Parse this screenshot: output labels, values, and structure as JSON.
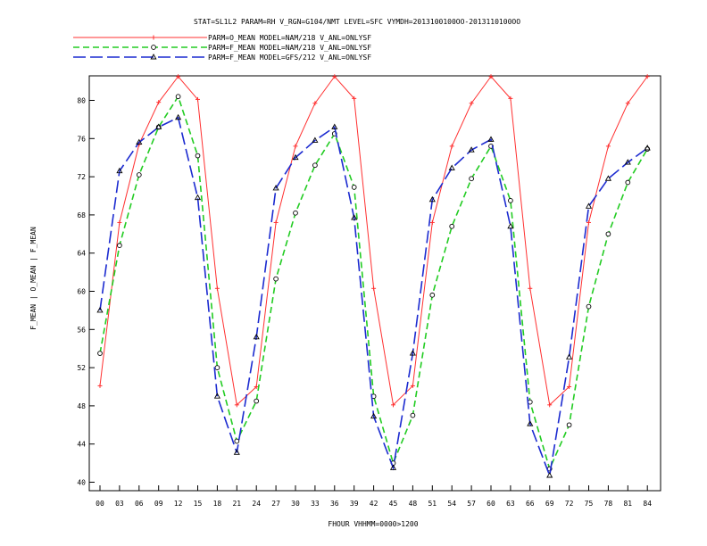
{
  "chart_data": {
    "type": "line",
    "title": "STAT=SL1L2 PARAM=RH V_RGN=G104/NMT LEVEL=SFC VYMDH=2013100100OO-2013110100OO",
    "xlabel": "FHOUR VHHMM=0000>1200",
    "ylabel": "F_MEAN | O_MEAN | F_MEAN",
    "categories": [
      "00",
      "03",
      "06",
      "09",
      "12",
      "15",
      "18",
      "21",
      "24",
      "27",
      "30",
      "33",
      "36",
      "39",
      "42",
      "45",
      "48",
      "51",
      "54",
      "57",
      "60",
      "63",
      "66",
      "69",
      "72",
      "75",
      "78",
      "81",
      "84"
    ],
    "ylim": [
      40,
      82
    ],
    "yticks": [
      40,
      44,
      48,
      52,
      56,
      60,
      64,
      68,
      72,
      76,
      80
    ],
    "grid": false,
    "legend_position": "top-left",
    "series": [
      {
        "name": "PARM=O_MEAN MODEL=NAM/218 V_ANL=ONLYSF",
        "color": "#ff3030",
        "dash": "solid",
        "marker": "plus",
        "values": [
          50.1,
          67.2,
          75.4,
          79.8,
          82.5,
          80.1,
          60.3,
          48.1,
          50.0,
          67.2,
          75.2,
          79.7,
          82.5,
          80.2,
          60.3,
          48.1,
          50.1,
          67.2,
          75.2,
          79.7,
          82.5,
          80.2,
          60.3,
          48.1,
          50.0,
          67.2,
          75.2,
          79.7,
          82.5
        ]
      },
      {
        "name": "PARM=F_MEAN MODEL=NAM/218 V_ANL=ONLYSF",
        "color": "#22cc22",
        "dash": "dashed",
        "marker": "circle",
        "values": [
          53.5,
          64.8,
          72.2,
          77.2,
          80.4,
          74.2,
          52.0,
          44.3,
          48.5,
          61.3,
          68.2,
          73.2,
          76.5,
          70.9,
          49.0,
          42.0,
          47.0,
          59.6,
          66.8,
          71.8,
          75.2,
          69.5,
          48.4,
          41.4,
          46.0,
          58.4,
          66.0,
          71.4,
          74.9
        ]
      },
      {
        "name": "PARM=F_MEAN MODEL=GFS/212 V_ANL=ONLYSF",
        "color": "#1c2bd0",
        "dash": "longdash",
        "marker": "triangle",
        "values": [
          58.0,
          72.6,
          75.6,
          77.2,
          78.2,
          69.8,
          49.0,
          43.1,
          55.2,
          70.8,
          74.0,
          75.8,
          77.2,
          67.7,
          46.9,
          41.5,
          53.5,
          69.6,
          72.9,
          74.8,
          75.9,
          66.8,
          46.1,
          40.7,
          53.1,
          68.9,
          71.8,
          73.5,
          75.0
        ]
      }
    ]
  }
}
